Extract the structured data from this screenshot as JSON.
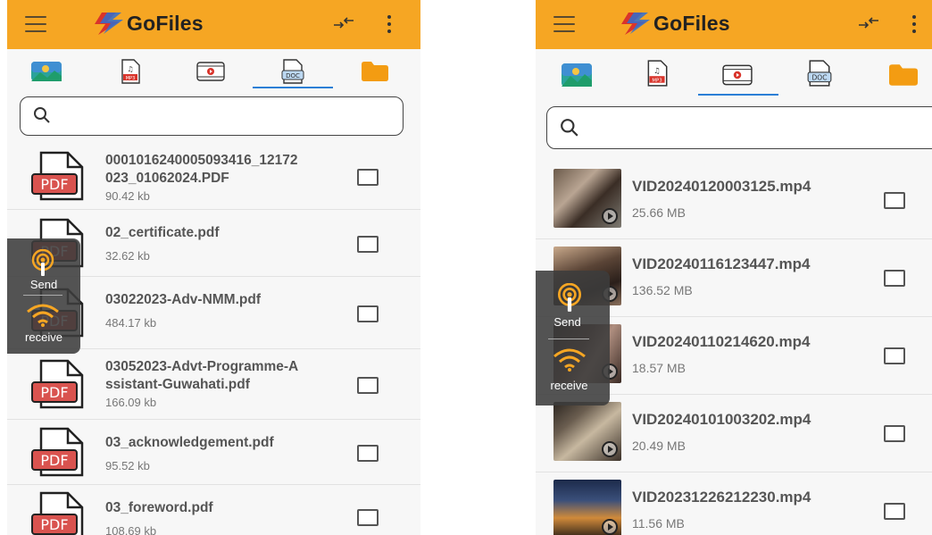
{
  "left": {
    "app_title": "GoFiles",
    "tabs": [
      "image-tab",
      "music-tab",
      "video-tab",
      "document-tab",
      "folder-tab"
    ],
    "active_tab": "document-tab",
    "search": {
      "placeholder": ""
    },
    "files": [
      {
        "name": "0001016240005093416_12172023_01062024.PDF",
        "line1": "0001016240005093416_12172",
        "line2": "023_01062024.PDF",
        "size": "90.42 kb"
      },
      {
        "name": "02_certificate.pdf",
        "line1": "02_certificate.pdf",
        "line2": "",
        "size": "32.62 kb"
      },
      {
        "name": "03022023-Adv-NMM.pdf",
        "line1": "03022023-Adv-NMM.pdf",
        "line2": "",
        "size": "484.17 kb"
      },
      {
        "name": "03052023-Advt-Programme-Assistant-Guwahati.pdf",
        "line1": "03052023-Advt-Programme-A",
        "line2": "ssistant-Guwahati.pdf",
        "size": "166.09 kb"
      },
      {
        "name": "03_acknowledgement.pdf",
        "line1": "03_acknowledgement.pdf",
        "line2": "",
        "size": "95.52 kb"
      },
      {
        "name": "03_foreword.pdf",
        "line1": "03_foreword.pdf",
        "line2": "",
        "size": "108.69 kb"
      }
    ],
    "icon_label": "PDF",
    "overlay": {
      "send": "Send",
      "receive": "receive"
    }
  },
  "right": {
    "app_title": "GoFiles",
    "active_tab": "video-tab",
    "search": {
      "placeholder": ""
    },
    "files": [
      {
        "name": "VID20240120003125.mp4",
        "size": "25.66 MB"
      },
      {
        "name": "VID20240116123447.mp4",
        "size": "136.52 MB"
      },
      {
        "name": "VID20240110214620.mp4",
        "size": "18.57 MB"
      },
      {
        "name": "VID20240101003202.mp4",
        "size": "20.49 MB"
      },
      {
        "name": "VID20231226212230.mp4",
        "size": "11.56 MB"
      }
    ],
    "overlay": {
      "send": "Send",
      "receive": "receive"
    }
  },
  "colors": {
    "appbar": "#f6a623",
    "accent": "#2b7fd6",
    "pdf_red": "#d9534f"
  }
}
